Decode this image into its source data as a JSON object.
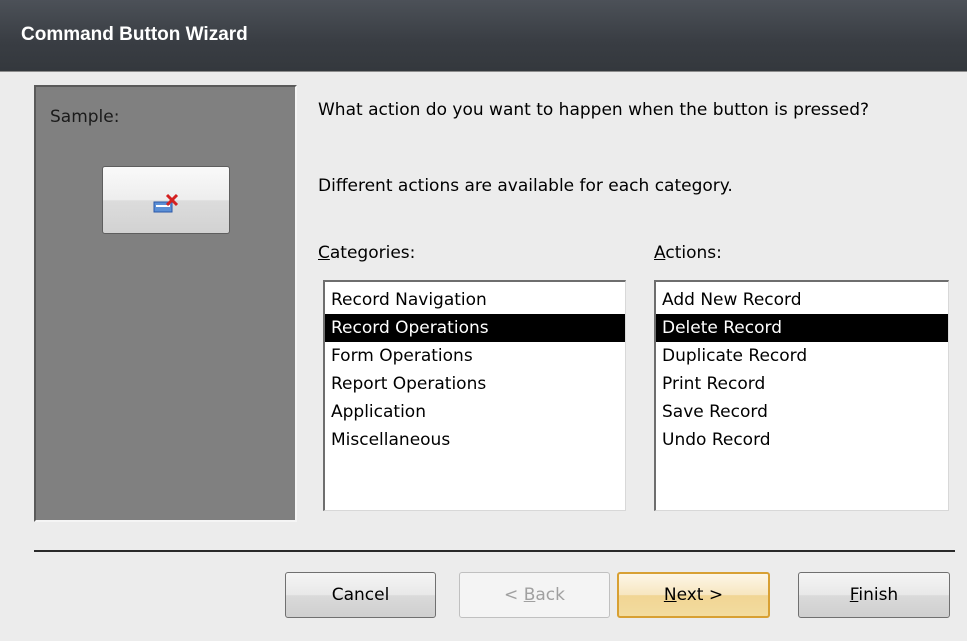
{
  "window": {
    "title": "Command Button Wizard"
  },
  "sample": {
    "label": "Sample:",
    "button_icon": "delete-record-icon"
  },
  "prompt": {
    "question": "What action do you want to happen when the button is pressed?",
    "hint": "Different actions are available for each category."
  },
  "categories": {
    "label_underlined": "C",
    "label_rest": "ategories:",
    "items": [
      "Record Navigation",
      "Record Operations",
      "Form Operations",
      "Report Operations",
      "Application",
      "Miscellaneous"
    ],
    "selected": "Record Operations"
  },
  "actions": {
    "label_underlined": "A",
    "label_rest": "ctions:",
    "items": [
      "Add New Record",
      "Delete Record",
      "Duplicate Record",
      "Print Record",
      "Save Record",
      "Undo Record"
    ],
    "selected": "Delete Record"
  },
  "buttons": {
    "cancel": "Cancel",
    "back_prefix": "< ",
    "back_underlined": "B",
    "back_rest": "ack",
    "next_underlined": "N",
    "next_rest": "ext >",
    "finish_underlined": "F",
    "finish_rest": "inish"
  },
  "colors": {
    "title_bar": "#393d43",
    "selection": "#000000",
    "sample_panel": "#808080",
    "default_button_border": "#d8a033"
  }
}
